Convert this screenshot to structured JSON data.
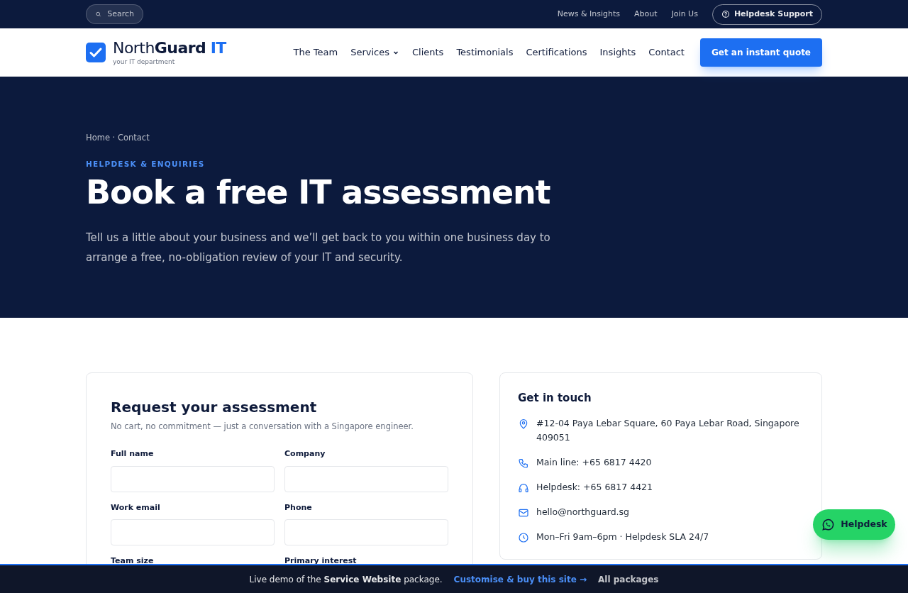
{
  "topbar": {
    "search": {
      "placeholder": "Search"
    },
    "links": [
      {
        "label": "News & Insights"
      },
      {
        "label": "About"
      },
      {
        "label": "Join Us"
      }
    ],
    "support_button": "Helpdesk Support"
  },
  "header": {
    "logo": {
      "name_plain": "North",
      "name_bold": "Guard",
      "name_accent": "IT",
      "tagline": "your IT department"
    },
    "nav": [
      {
        "label": "The Team",
        "has_menu": false
      },
      {
        "label": "Services",
        "has_menu": true
      },
      {
        "label": "Clients",
        "has_menu": false
      },
      {
        "label": "Testimonials",
        "has_menu": false
      },
      {
        "label": "Certifications",
        "has_menu": false
      },
      {
        "label": "Insights",
        "has_menu": false
      },
      {
        "label": "Contact",
        "has_menu": false
      }
    ],
    "cta": "Get an instant quote"
  },
  "hero": {
    "breadcrumb": "Home · Contact",
    "eyebrow": "HELPDESK & ENQUIRIES",
    "title": "Book a free IT assessment",
    "lead": "Tell us a little about your business and we’ll get back to you within one business day to arrange a free, no-obligation review of your IT and security."
  },
  "form": {
    "title": "Request your assessment",
    "subtitle": "No cart, no commitment — just a conversation with a Singapore engineer.",
    "fields": [
      {
        "label": "Full name"
      },
      {
        "label": "Company"
      },
      {
        "label": "Work email"
      },
      {
        "label": "Phone"
      }
    ],
    "partly_hidden_labels": [
      "Team size",
      "Primary interest"
    ]
  },
  "contact": {
    "title": "Get in touch",
    "items": [
      {
        "kind": "address",
        "text": "#12-04 Paya Lebar Square, 60 Paya Lebar Road, Singapore 409051"
      },
      {
        "kind": "phone",
        "text": "Main line: +65 6817 4420"
      },
      {
        "kind": "headset",
        "text": "Helpdesk: +65 6817 4421"
      },
      {
        "kind": "email",
        "text": "hello@northguard.sg"
      },
      {
        "kind": "hours",
        "text": "Mon–Fri 9am–6pm · Helpdesk SLA 24/7"
      }
    ]
  },
  "chat_button": "Helpdesk",
  "demo_bar": {
    "text": "Live demo of the **Service Website** package.",
    "buy_link": "Customise & buy this site →",
    "packages_link": "All packages"
  }
}
